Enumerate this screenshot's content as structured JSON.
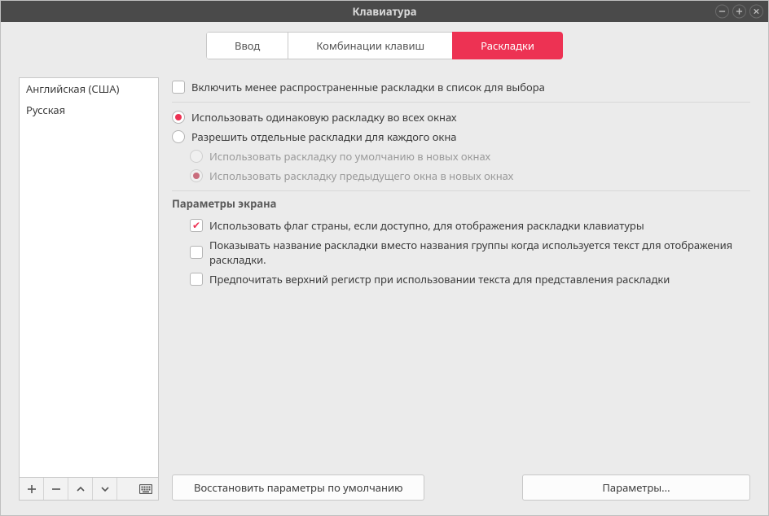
{
  "window": {
    "title": "Клавиатура"
  },
  "tabs": {
    "input": "Ввод",
    "shortcuts": "Комбинации клавиш",
    "layouts": "Раскладки"
  },
  "layouts": [
    "Английская (США)",
    "Русская"
  ],
  "options": {
    "include_rare": "Включить менее распространенные раскладки в список для выбора",
    "same_all_windows": "Использовать одинаковую раскладку во всех окнах",
    "separate_per_window": "Разрешить отдельные раскладки для каждого окна",
    "default_in_new": "Использовать раскладку по умолчанию в новых окнах",
    "previous_in_new": "Использовать раскладку предыдущего окна в новых окнах"
  },
  "display": {
    "title": "Параметры экрана",
    "use_flag": "Использовать флаг страны, если доступно, для отображения раскладки клавиатуры",
    "show_name": "Показывать название раскладки вместо названия группы когда используется текст для отображения раскладки.",
    "uppercase": "Предпочитать верхний регистр при использовании текста для представления раскладки"
  },
  "footer": {
    "restore": "Восстановить параметры по умолчанию",
    "params": "Параметры..."
  },
  "state": {
    "include_rare_checked": false,
    "layout_mode": "same",
    "use_flag_checked": true,
    "show_name_checked": false,
    "uppercase_checked": false
  }
}
